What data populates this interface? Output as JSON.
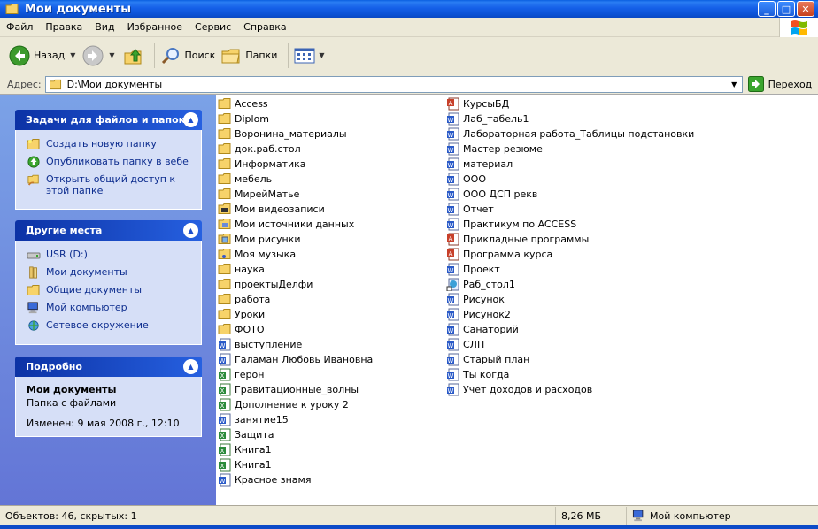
{
  "window": {
    "title": "Мои документы"
  },
  "menu": [
    "Файл",
    "Правка",
    "Вид",
    "Избранное",
    "Сервис",
    "Справка"
  ],
  "toolbar": {
    "back": "Назад",
    "search": "Поиск",
    "folders": "Папки"
  },
  "address": {
    "label": "Адрес:",
    "path": "D:\\Мои документы",
    "go": "Переход"
  },
  "tasks": {
    "title": "Задачи для файлов и папок",
    "items": [
      "Создать новую папку",
      "Опубликовать папку в вебе",
      "Открыть общий доступ к этой папке"
    ]
  },
  "places": {
    "title": "Другие места",
    "items": [
      "USR (D:)",
      "Мои документы",
      "Общие документы",
      "Мой компьютер",
      "Сетевое окружение"
    ]
  },
  "details": {
    "title": "Подробно",
    "name": "Мои документы",
    "type": "Папка с файлами",
    "modified": "Изменен: 9 мая 2008 г., 12:10"
  },
  "files_col1": [
    {
      "name": "Access",
      "icon": "folder-icon"
    },
    {
      "name": "Diplom",
      "icon": "folder-icon"
    },
    {
      "name": "Воронина_материалы",
      "icon": "folder-icon"
    },
    {
      "name": "док.раб.стол",
      "icon": "folder-icon"
    },
    {
      "name": "Информатика",
      "icon": "folder-icon"
    },
    {
      "name": "мебель",
      "icon": "folder-icon"
    },
    {
      "name": "МирейМатье",
      "icon": "folder-icon"
    },
    {
      "name": "Мои видеозаписи",
      "icon": "video-folder-icon"
    },
    {
      "name": "Мои источники данных",
      "icon": "data-sources-folder-icon"
    },
    {
      "name": "Мои рисунки",
      "icon": "pictures-folder-icon"
    },
    {
      "name": "Моя музыка",
      "icon": "music-folder-icon"
    },
    {
      "name": "наука",
      "icon": "folder-icon"
    },
    {
      "name": "проектыДелфи",
      "icon": "folder-icon"
    },
    {
      "name": "работа",
      "icon": "folder-icon"
    },
    {
      "name": "Уроки",
      "icon": "folder-icon"
    },
    {
      "name": "ФОТО",
      "icon": "folder-icon"
    },
    {
      "name": "выступление",
      "icon": "word-doc-icon"
    },
    {
      "name": "Галаман Любовь Ивановна",
      "icon": "word-doc-icon"
    },
    {
      "name": "герон",
      "icon": "excel-doc-icon"
    },
    {
      "name": "Гравитационные_волны",
      "icon": "excel-doc-icon"
    },
    {
      "name": "Дополнение к уроку 2",
      "icon": "excel-doc-icon"
    },
    {
      "name": "занятие15",
      "icon": "word-doc-icon"
    },
    {
      "name": "Защита",
      "icon": "excel-doc-icon"
    },
    {
      "name": "Книга1",
      "icon": "excel-doc-icon"
    },
    {
      "name": "Книга1",
      "icon": "excel-doc-icon"
    },
    {
      "name": "Красное знамя",
      "icon": "word-doc-icon"
    }
  ],
  "files_col2": [
    {
      "name": "КурсыБД",
      "icon": "access-db-icon"
    },
    {
      "name": "Лаб_табель1",
      "icon": "word-doc-icon"
    },
    {
      "name": "Лабораторная работа_Таблицы подстановки",
      "icon": "word-doc-icon"
    },
    {
      "name": "Мастер резюме",
      "icon": "word-doc-icon"
    },
    {
      "name": "материал",
      "icon": "word-doc-icon"
    },
    {
      "name": "ООО",
      "icon": "word-doc-icon"
    },
    {
      "name": "ООО ДСП рекв",
      "icon": "word-doc-icon"
    },
    {
      "name": "Отчет",
      "icon": "word-doc-icon"
    },
    {
      "name": "Практикум по ACCESS",
      "icon": "word-doc-icon"
    },
    {
      "name": "Прикладные программы",
      "icon": "access-db-icon"
    },
    {
      "name": "Программа курса",
      "icon": "access-db-icon"
    },
    {
      "name": "Проект",
      "icon": "word-doc-icon"
    },
    {
      "name": "Раб_стол1",
      "icon": "shortcut-icon"
    },
    {
      "name": "Рисунок",
      "icon": "word-doc-icon"
    },
    {
      "name": "Рисунок2",
      "icon": "word-doc-icon"
    },
    {
      "name": "Санаторий",
      "icon": "word-doc-icon"
    },
    {
      "name": "СЛП",
      "icon": "word-doc-icon"
    },
    {
      "name": "Старый план",
      "icon": "word-doc-icon"
    },
    {
      "name": "Ты когда",
      "icon": "word-doc-icon"
    },
    {
      "name": "Учет доходов и расходов",
      "icon": "word-doc-icon"
    }
  ],
  "status": {
    "objects": "Объектов: 46, скрытых: 1",
    "size": "8,26 МБ",
    "location": "Мой компьютер"
  }
}
